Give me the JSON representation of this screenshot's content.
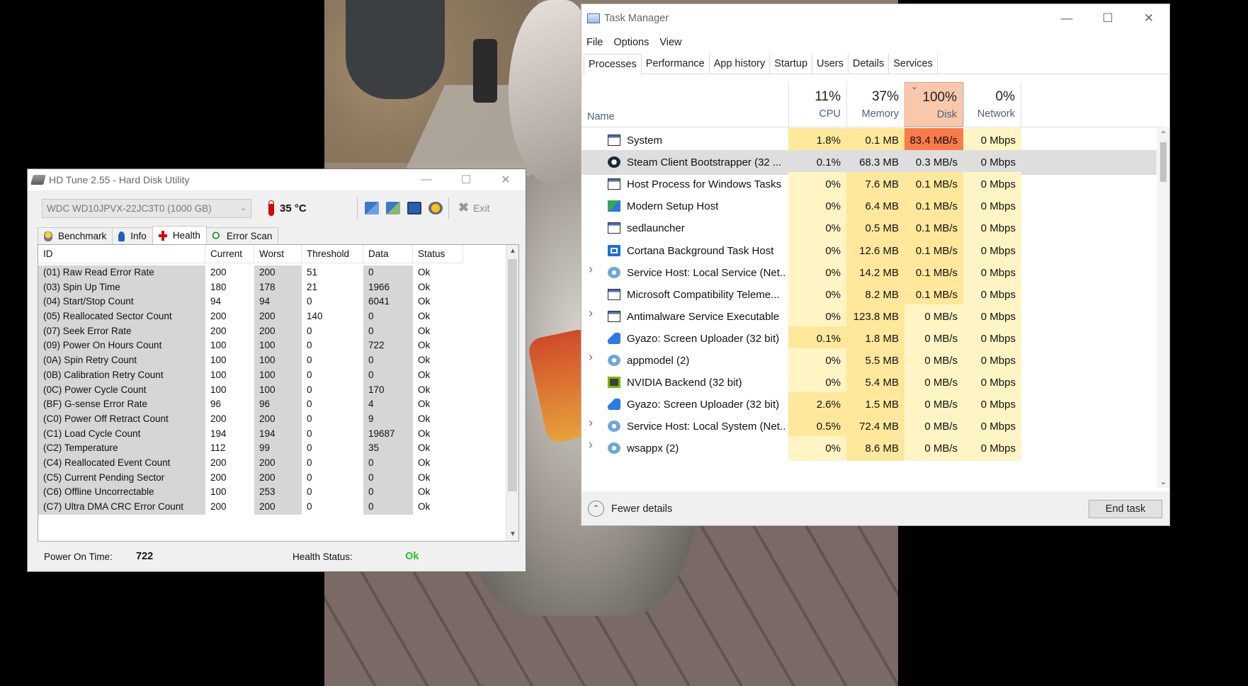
{
  "hdtune": {
    "title": "HD Tune 2.55 - Hard Disk Utility",
    "drive": "WDC    WD10JPVX-22JC3T0 (1000 GB)",
    "temperature": "35 °C",
    "exit_label": "Exit",
    "tabs": [
      "Benchmark",
      "Info",
      "Health",
      "Error Scan"
    ],
    "active_tab": "Health",
    "columns": [
      "ID",
      "Current",
      "Worst",
      "Threshold",
      "Data",
      "Status"
    ],
    "rows": [
      [
        "(01) Raw Read Error Rate",
        "200",
        "200",
        "51",
        "0",
        "Ok"
      ],
      [
        "(03) Spin Up Time",
        "180",
        "178",
        "21",
        "1966",
        "Ok"
      ],
      [
        "(04) Start/Stop Count",
        "94",
        "94",
        "0",
        "6041",
        "Ok"
      ],
      [
        "(05) Reallocated Sector Count",
        "200",
        "200",
        "140",
        "0",
        "Ok"
      ],
      [
        "(07) Seek Error Rate",
        "200",
        "200",
        "0",
        "0",
        "Ok"
      ],
      [
        "(09) Power On Hours Count",
        "100",
        "100",
        "0",
        "722",
        "Ok"
      ],
      [
        "(0A) Spin Retry Count",
        "100",
        "100",
        "0",
        "0",
        "Ok"
      ],
      [
        "(0B) Calibration Retry Count",
        "100",
        "100",
        "0",
        "0",
        "Ok"
      ],
      [
        "(0C) Power Cycle Count",
        "100",
        "100",
        "0",
        "170",
        "Ok"
      ],
      [
        "(BF) G-sense Error Rate",
        "96",
        "96",
        "0",
        "4",
        "Ok"
      ],
      [
        "(C0) Power Off Retract Count",
        "200",
        "200",
        "0",
        "9",
        "Ok"
      ],
      [
        "(C1) Load Cycle Count",
        "194",
        "194",
        "0",
        "19687",
        "Ok"
      ],
      [
        "(C2) Temperature",
        "112",
        "99",
        "0",
        "35",
        "Ok"
      ],
      [
        "(C4) Reallocated Event Count",
        "200",
        "200",
        "0",
        "0",
        "Ok"
      ],
      [
        "(C5) Current Pending Sector",
        "200",
        "200",
        "0",
        "0",
        "Ok"
      ],
      [
        "(C6) Offline Uncorrectable",
        "100",
        "253",
        "0",
        "0",
        "Ok"
      ],
      [
        "(C7) Ultra DMA CRC Error Count",
        "200",
        "200",
        "0",
        "0",
        "Ok"
      ]
    ],
    "power_on_time_label": "Power On Time:",
    "power_on_time": "722",
    "health_status_label": "Health Status:",
    "health_status": "Ok",
    "colors": {
      "ok": "#1ec41e",
      "thermo": "#d20a0a"
    }
  },
  "taskmgr": {
    "title": "Task Manager",
    "menu": [
      "File",
      "Options",
      "View"
    ],
    "tabs": [
      "Processes",
      "Performance",
      "App history",
      "Startup",
      "Users",
      "Details",
      "Services"
    ],
    "active_tab": "Processes",
    "name_header": "Name",
    "columns": [
      {
        "pct": "11%",
        "label": "CPU"
      },
      {
        "pct": "37%",
        "label": "Memory"
      },
      {
        "pct": "100%",
        "label": "Disk"
      },
      {
        "pct": "0%",
        "label": "Network"
      }
    ],
    "processes": [
      {
        "name": "System",
        "icon": "window-icon",
        "expandable": false,
        "cpu": "1.8%",
        "mem": "0.1 MB",
        "disk": "83.4 MB/s",
        "net": "0 Mbps"
      },
      {
        "name": "Steam Client Bootstrapper (32 ...",
        "icon": "steam-icon",
        "expandable": false,
        "cpu": "0.1%",
        "mem": "68.3 MB",
        "disk": "0.3 MB/s",
        "net": "0 Mbps",
        "selected": true
      },
      {
        "name": "Host Process for Windows Tasks",
        "icon": "window-icon",
        "expandable": false,
        "cpu": "0%",
        "mem": "7.6 MB",
        "disk": "0.1 MB/s",
        "net": "0 Mbps"
      },
      {
        "name": "Modern Setup Host",
        "icon": "setup-icon",
        "expandable": false,
        "cpu": "0%",
        "mem": "6.4 MB",
        "disk": "0.1 MB/s",
        "net": "0 Mbps"
      },
      {
        "name": "sedlauncher",
        "icon": "window-icon",
        "expandable": false,
        "cpu": "0%",
        "mem": "0.5 MB",
        "disk": "0.1 MB/s",
        "net": "0 Mbps"
      },
      {
        "name": "Cortana Background Task Host",
        "icon": "cortana-icon",
        "expandable": false,
        "cpu": "0%",
        "mem": "12.6 MB",
        "disk": "0.1 MB/s",
        "net": "0 Mbps"
      },
      {
        "name": "Service Host: Local Service (Net...",
        "icon": "gear-icon",
        "expandable": true,
        "cpu": "0%",
        "mem": "14.2 MB",
        "disk": "0.1 MB/s",
        "net": "0 Mbps"
      },
      {
        "name": "Microsoft Compatibility Teleme...",
        "icon": "window-icon",
        "expandable": false,
        "cpu": "0%",
        "mem": "8.2 MB",
        "disk": "0.1 MB/s",
        "net": "0 Mbps"
      },
      {
        "name": "Antimalware Service Executable",
        "icon": "window-icon",
        "expandable": true,
        "cpu": "0%",
        "mem": "123.8 MB",
        "disk": "0 MB/s",
        "net": "0 Mbps"
      },
      {
        "name": "Gyazo: Screen Uploader (32 bit)",
        "icon": "gyazo-icon",
        "expandable": false,
        "cpu": "0.1%",
        "mem": "1.8 MB",
        "disk": "0 MB/s",
        "net": "0 Mbps"
      },
      {
        "name": "appmodel (2)",
        "icon": "gear-icon",
        "expandable": true,
        "cpu": "0%",
        "mem": "5.5 MB",
        "disk": "0 MB/s",
        "net": "0 Mbps"
      },
      {
        "name": "NVIDIA Backend (32 bit)",
        "icon": "nvidia-icon",
        "expandable": false,
        "cpu": "0%",
        "mem": "5.4 MB",
        "disk": "0 MB/s",
        "net": "0 Mbps"
      },
      {
        "name": "Gyazo: Screen Uploader (32 bit)",
        "icon": "gyazo-icon",
        "expandable": false,
        "cpu": "2.6%",
        "mem": "1.5 MB",
        "disk": "0 MB/s",
        "net": "0 Mbps"
      },
      {
        "name": "Service Host: Local System (Net...",
        "icon": "gear-icon",
        "expandable": true,
        "cpu": "0.5%",
        "mem": "72.4 MB",
        "disk": "0 MB/s",
        "net": "0 Mbps"
      },
      {
        "name": "wsappx (2)",
        "icon": "gear-icon",
        "expandable": true,
        "cpu": "0%",
        "mem": "8.6 MB",
        "disk": "0 MB/s",
        "net": "0 Mbps"
      }
    ],
    "fewer_details": "Fewer details",
    "end_task": "End task",
    "colors": {
      "heat_low": "#fff4c4",
      "heat_mid": "#ffe79b",
      "heat_high": "#fa7a4a",
      "selected": "#dedede"
    }
  }
}
